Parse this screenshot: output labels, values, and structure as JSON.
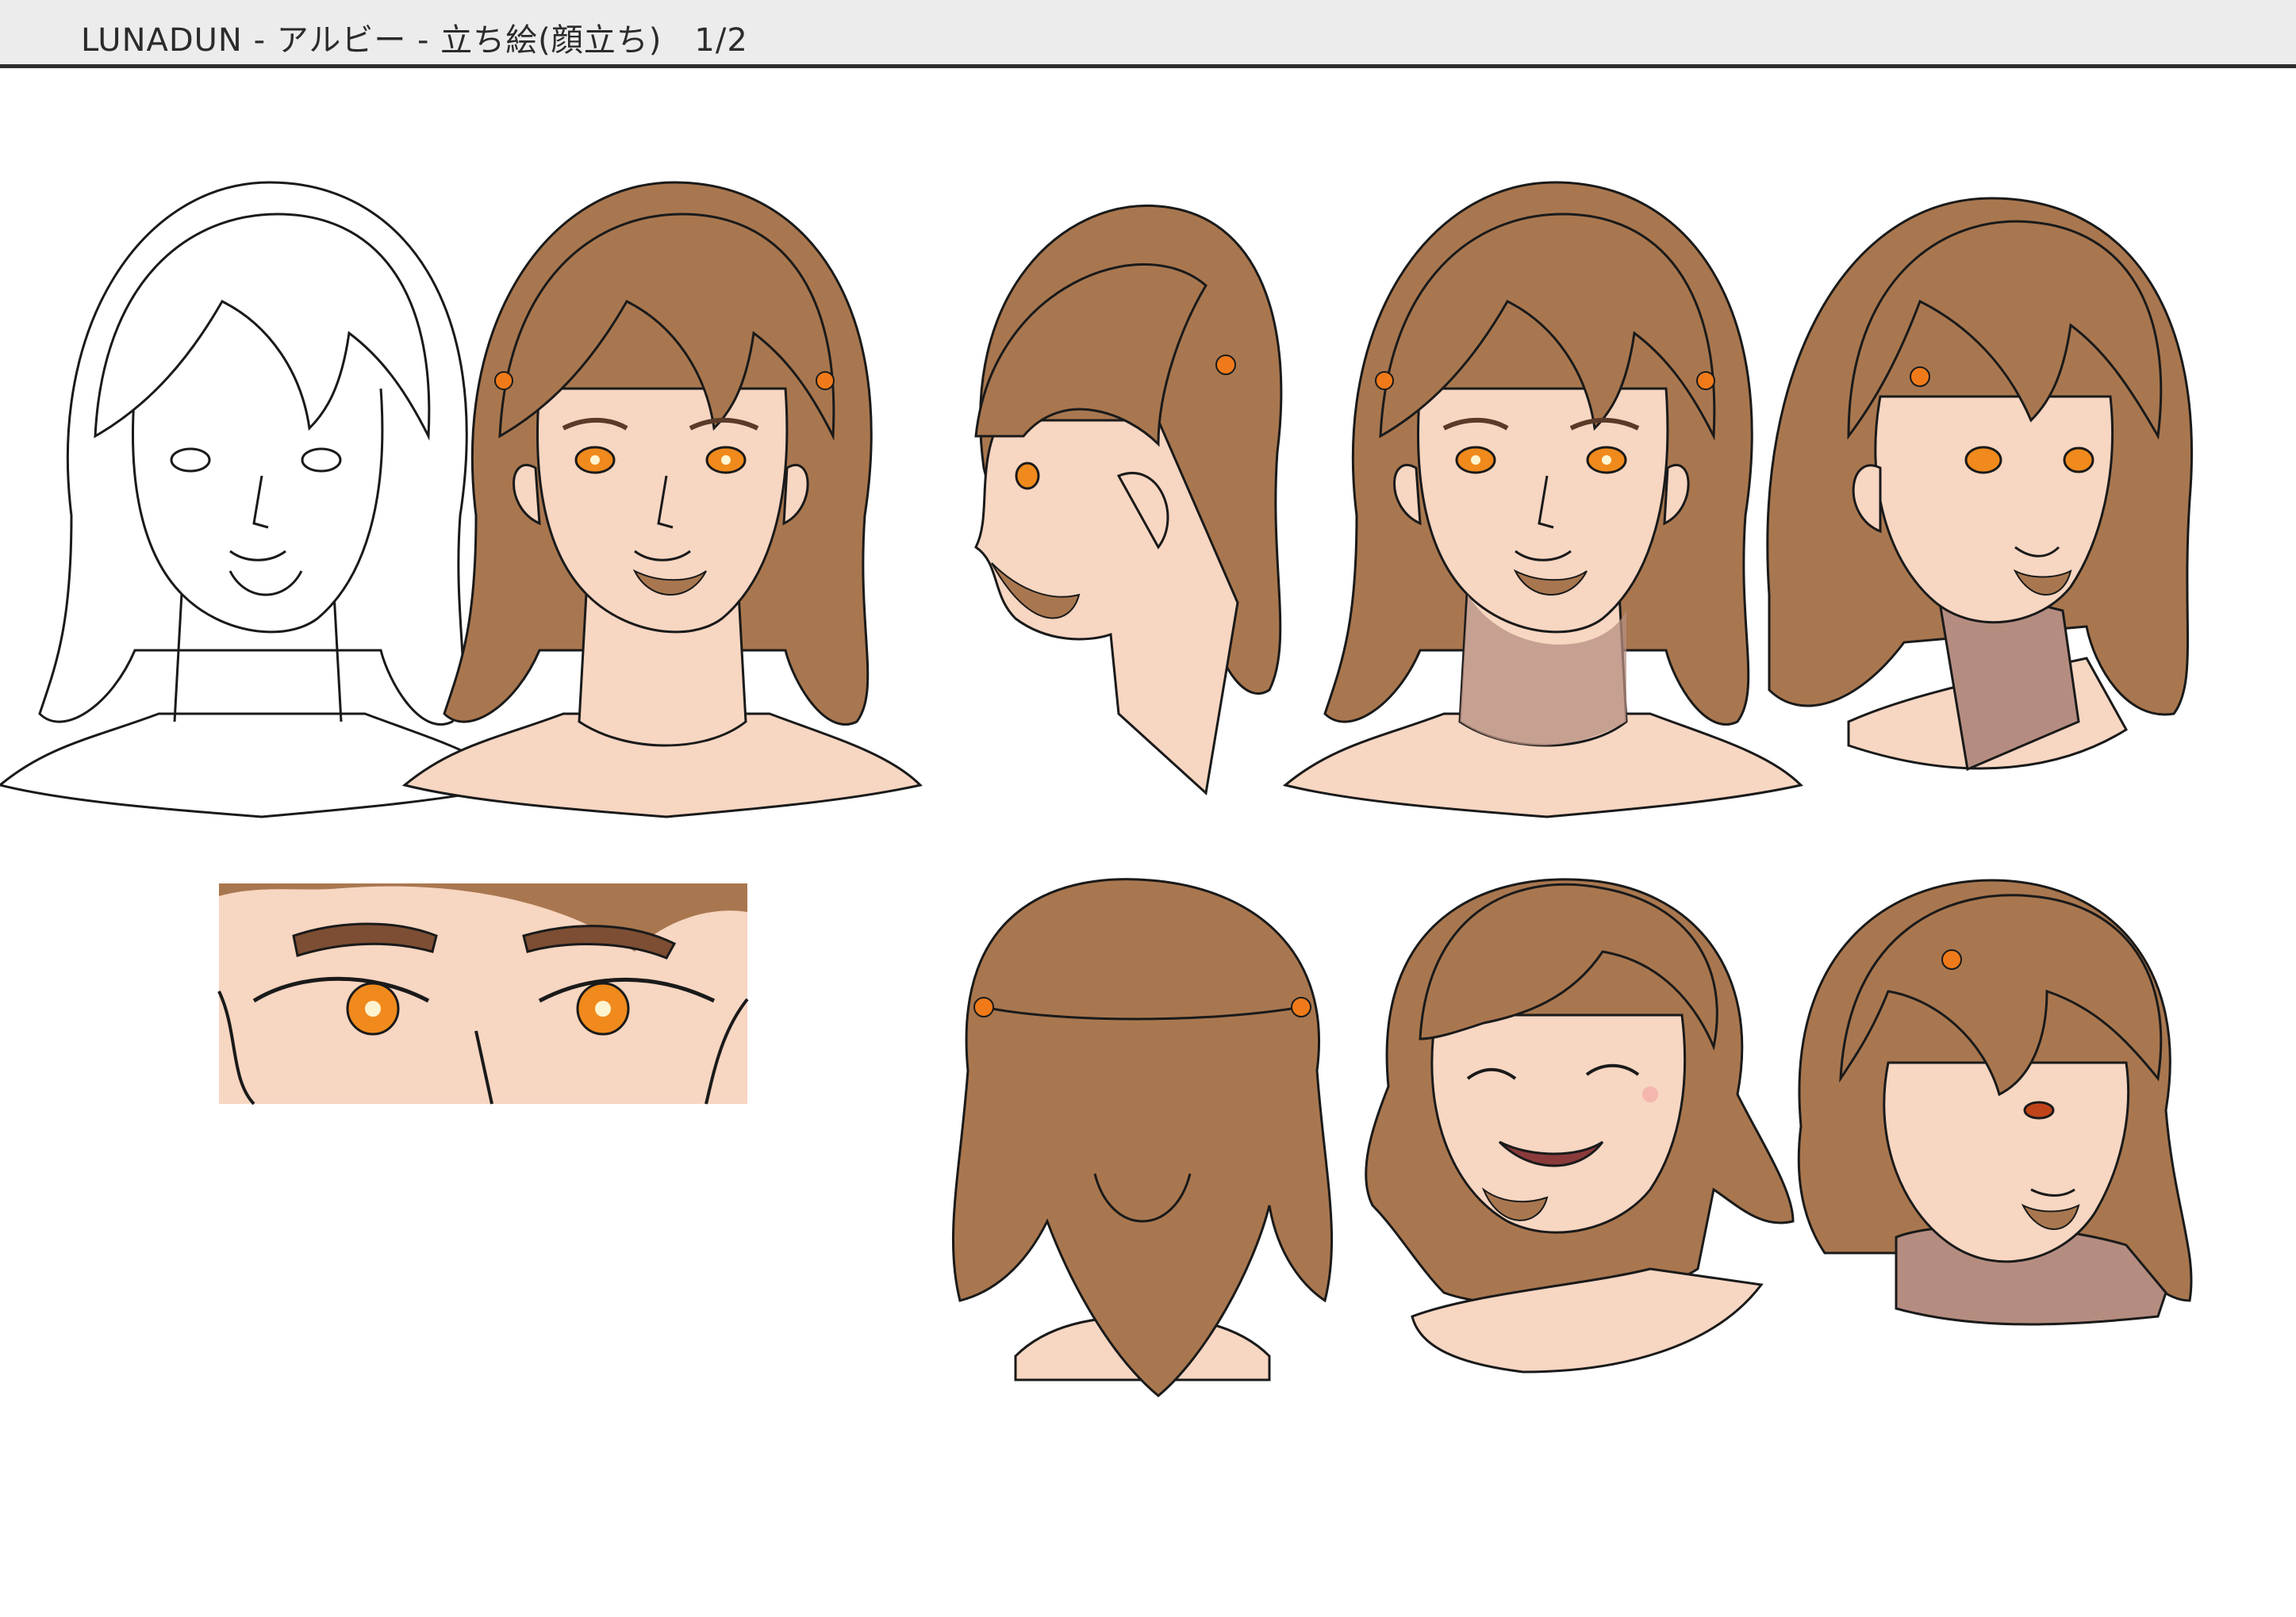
{
  "header": {
    "title": "LUNADUN - アルビー - 立ち絵(顔立ち)　1/2"
  },
  "colors": {
    "header_bg": "#ececec",
    "hair": "#a9774f",
    "hair_shadow": "#7d4e33",
    "skin": "#f7d6c2",
    "skin_shadow": "#b58d80",
    "eye": "#f08a1c",
    "hair_tie": "#f07a19",
    "line": "#1a1a1a"
  },
  "views": [
    {
      "id": "lineart-front",
      "icon": "lineart-head-icon"
    },
    {
      "id": "color-front",
      "icon": "front-head-icon"
    },
    {
      "id": "profile-left",
      "icon": "profile-head-icon"
    },
    {
      "id": "front-shaded",
      "icon": "front-shaded-head-icon"
    },
    {
      "id": "three-quarter",
      "icon": "three-quarter-head-icon"
    },
    {
      "id": "back",
      "icon": "back-head-icon"
    },
    {
      "id": "laughing",
      "icon": "laughing-head-icon"
    },
    {
      "id": "looking-down",
      "icon": "looking-down-head-icon"
    },
    {
      "id": "eye-closeup",
      "icon": "eye-closeup-icon"
    }
  ]
}
